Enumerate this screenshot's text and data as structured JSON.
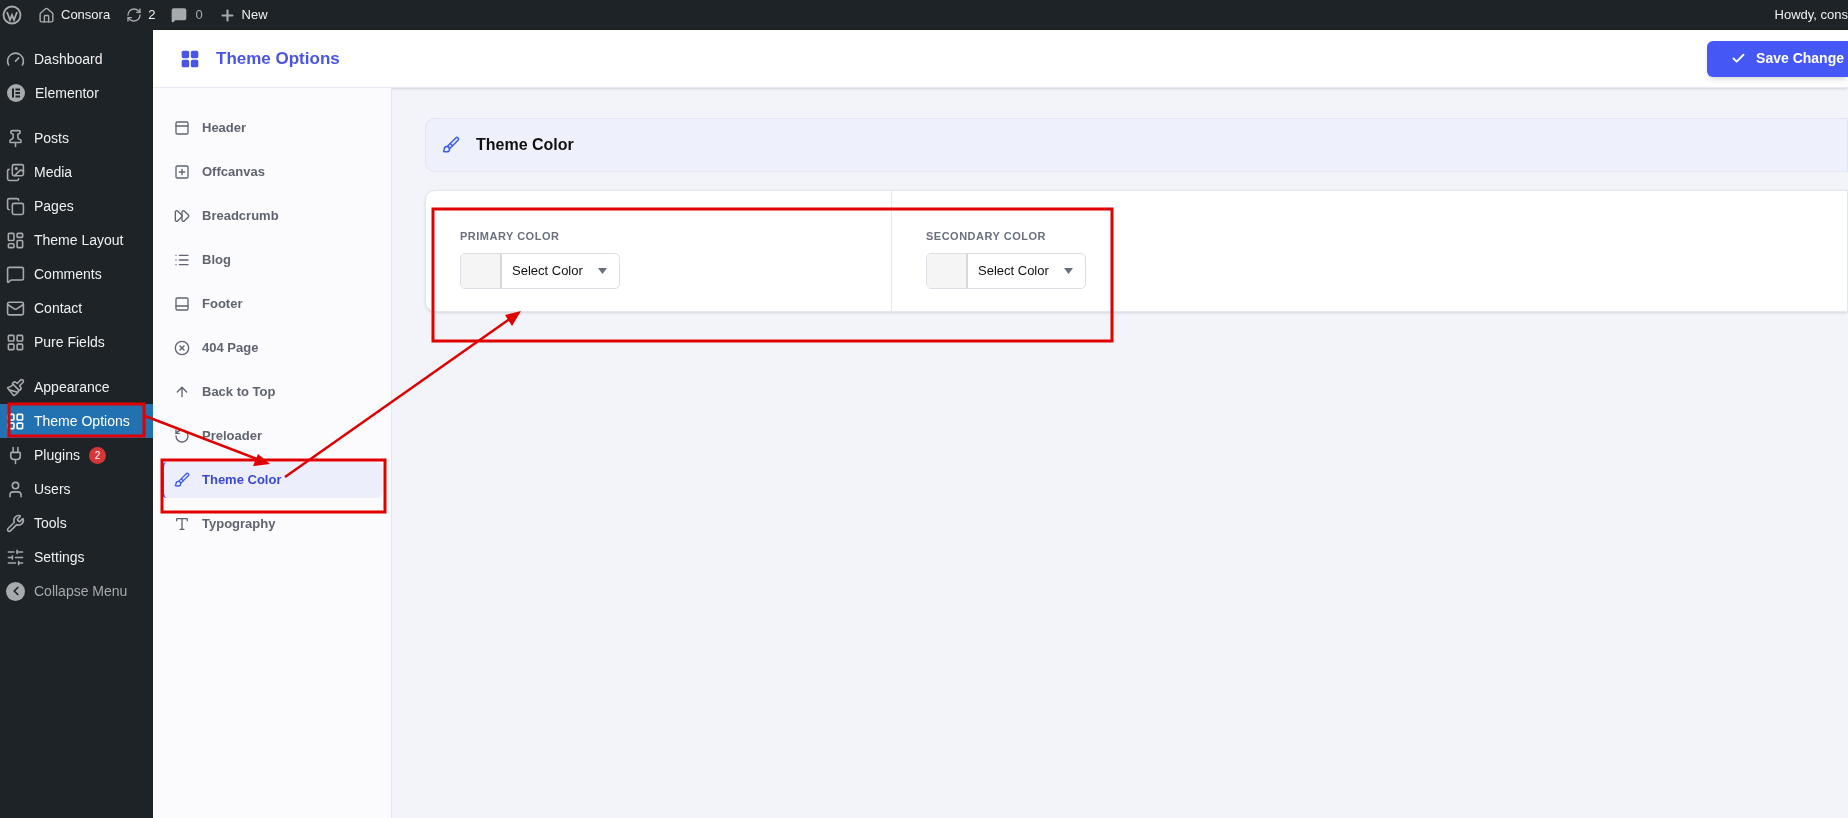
{
  "admin_bar": {
    "site_name": "Consora",
    "updates": "2",
    "comments": "0",
    "new": "New",
    "greeting": "Howdy, cons"
  },
  "admin_menu": {
    "groups": [
      [
        {
          "label": "Dashboard",
          "selected": false
        },
        {
          "label": "Elementor",
          "selected": false
        }
      ],
      [
        {
          "label": "Posts",
          "selected": false
        },
        {
          "label": "Media",
          "selected": false
        },
        {
          "label": "Pages",
          "selected": false
        },
        {
          "label": "Theme Layout",
          "selected": false
        },
        {
          "label": "Comments",
          "selected": false
        },
        {
          "label": "Contact",
          "selected": false
        },
        {
          "label": "Pure Fields",
          "selected": false
        }
      ],
      [
        {
          "label": "Appearance",
          "selected": false
        },
        {
          "label": "Theme Options",
          "selected": true
        },
        {
          "label": "Plugins",
          "selected": false,
          "badge": "2"
        },
        {
          "label": "Users",
          "selected": false
        },
        {
          "label": "Tools",
          "selected": false
        },
        {
          "label": "Settings",
          "selected": false
        }
      ]
    ],
    "collapse": "Collapse Menu"
  },
  "plugin": {
    "title": "Theme Options",
    "save_button": "Save Change"
  },
  "options_nav": [
    {
      "label": "Header",
      "selected": false
    },
    {
      "label": "Offcanvas",
      "selected": false
    },
    {
      "label": "Breadcrumb",
      "selected": false
    },
    {
      "label": "Blog",
      "selected": false
    },
    {
      "label": "Footer",
      "selected": false
    },
    {
      "label": "404 Page",
      "selected": false
    },
    {
      "label": "Back to Top",
      "selected": false
    },
    {
      "label": "Preloader",
      "selected": false
    },
    {
      "label": "Theme Color",
      "selected": true
    },
    {
      "label": "Typography",
      "selected": false
    }
  ],
  "section": {
    "title": "Theme Color",
    "fields": [
      {
        "label": "PRIMARY COLOR",
        "button": "Select Color"
      },
      {
        "label": "SECONDARY COLOR",
        "button": "Select Color"
      }
    ]
  }
}
